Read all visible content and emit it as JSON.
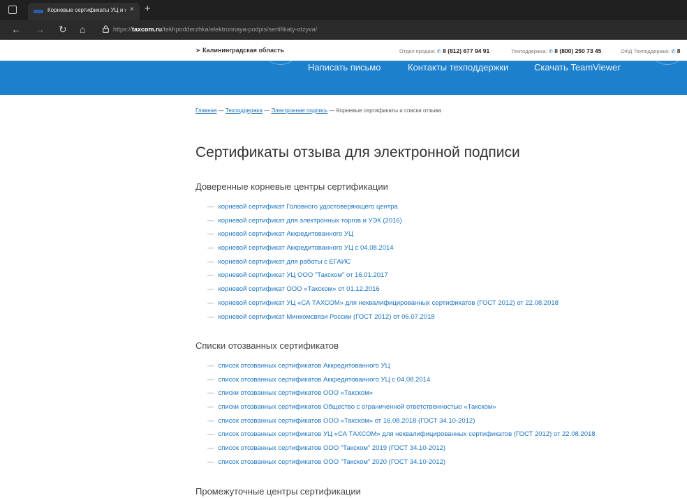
{
  "browser": {
    "tab_title": "Корневые сертификаты УЦ и с",
    "tab_close": "×",
    "new_tab": "+",
    "url_prefix": "https://",
    "url_domain": "taxcom.ru",
    "url_path": "/tekhpodderzhka/elektronnaya-podpis/sertifikaty-otzyva/"
  },
  "infobar": {
    "region": "Калининградская область",
    "sales_label": "Отдел продаж:",
    "sales_phone": "8 (812) 677 94 91",
    "support_label": "Техподдержка:",
    "support_phone": "8 (800) 250 73 45",
    "ofd_label": "ОФД Техподдержка:",
    "ofd_phone": "8"
  },
  "blueband": {
    "links": [
      "Написать письмо",
      "Контакты техподдержки",
      "Скачать TeamViewer"
    ]
  },
  "breadcrumb": {
    "items": [
      "Главная",
      "Техподдержка",
      "Электронная подпись"
    ],
    "current": "Корневые сертификаты и списки отзыва",
    "sep": " — "
  },
  "page": {
    "title": "Сертификаты отзыва для электронной подписи",
    "dash": "—"
  },
  "sections": [
    {
      "heading": "Доверенные корневые центры сертификации",
      "items": [
        "корневой сертификат Головного удостоверяющего центра",
        "корневой сертификат для электронных торгов и УЭК (2016)",
        "корневой сертификат Аккредитованного УЦ",
        "корневой сертификат Аккредитованного УЦ с 04.08.2014",
        "корневой сертификат для работы с ЕГАИС",
        "корневой сертификат УЦ ООО \"Такском\" от 16.01.2017",
        "корневой сертификат ООО «Такском» от 01.12.2016",
        "корневой сертификат УЦ «СА ТАХСОМ» для неквалифицированных сертификатов (ГОСТ 2012) от 22.08.2018",
        "корневой сертификат Минкомсвязи России (ГОСТ 2012) от 06.07.2018"
      ]
    },
    {
      "heading": "Списки отозванных сертификатов",
      "items": [
        "список отозванных сертификатов Аккредитованного УЦ",
        "список отозванных сертификатов Аккредитованного УЦ с 04.08.2014",
        "списки отозванных сертификатов ООО «Такском»",
        "списки отозванных сертификатов Общество с ограниченной ответственностью «Такском»",
        "список отозванных сертификатов ООО «Такском» от 16.08.2018 (ГОСТ 34.10-2012)",
        "список отозванных сертификатов УЦ «СА ТАХСОМ» для неквалифицированных сертификатов (ГОСТ 2012) от 22.08.2018",
        "список отозванных сертификатов ООО \"Такском\" 2019 (ГОСТ 34.10-2012)",
        "список отозванных сертификатов ООО \"Такском\" 2020 (ГОСТ 34.10-2012)"
      ]
    },
    {
      "heading": "Промежуточные центры сертификации",
      "items": []
    }
  ],
  "colors": {
    "accent_blue": "#1d80cc",
    "link": "#1a74c4",
    "browser_dark": "#202020"
  }
}
